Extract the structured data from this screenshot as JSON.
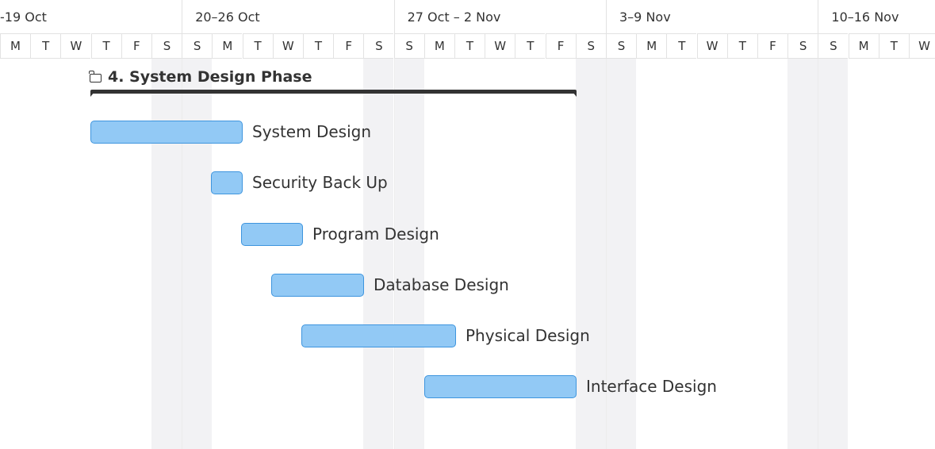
{
  "timeline": {
    "weeks": [
      "-19 Oct",
      "20–26 Oct",
      "27 Oct – 2 Nov",
      "3–9 Nov",
      "10–16 Nov"
    ],
    "days": [
      "M",
      "T",
      "W",
      "T",
      "F",
      "S",
      "S",
      "M",
      "T",
      "W",
      "T",
      "F",
      "S",
      "S",
      "M",
      "T",
      "W",
      "T",
      "F",
      "S",
      "S",
      "M",
      "T",
      "W",
      "T",
      "F",
      "S",
      "S",
      "M",
      "T",
      "W"
    ]
  },
  "phase": {
    "title": "4. System Design Phase",
    "icon": "folder-icon"
  },
  "tasks": [
    {
      "name": "System Design"
    },
    {
      "name": "Security Back Up"
    },
    {
      "name": "Program Design"
    },
    {
      "name": "Database Design"
    },
    {
      "name": "Physical Design"
    },
    {
      "name": "Interface Design"
    }
  ],
  "colors": {
    "task_fill": "#92c9f5",
    "task_border": "#3e95de",
    "summary": "#333333",
    "weekend": "#f2f2f4"
  }
}
